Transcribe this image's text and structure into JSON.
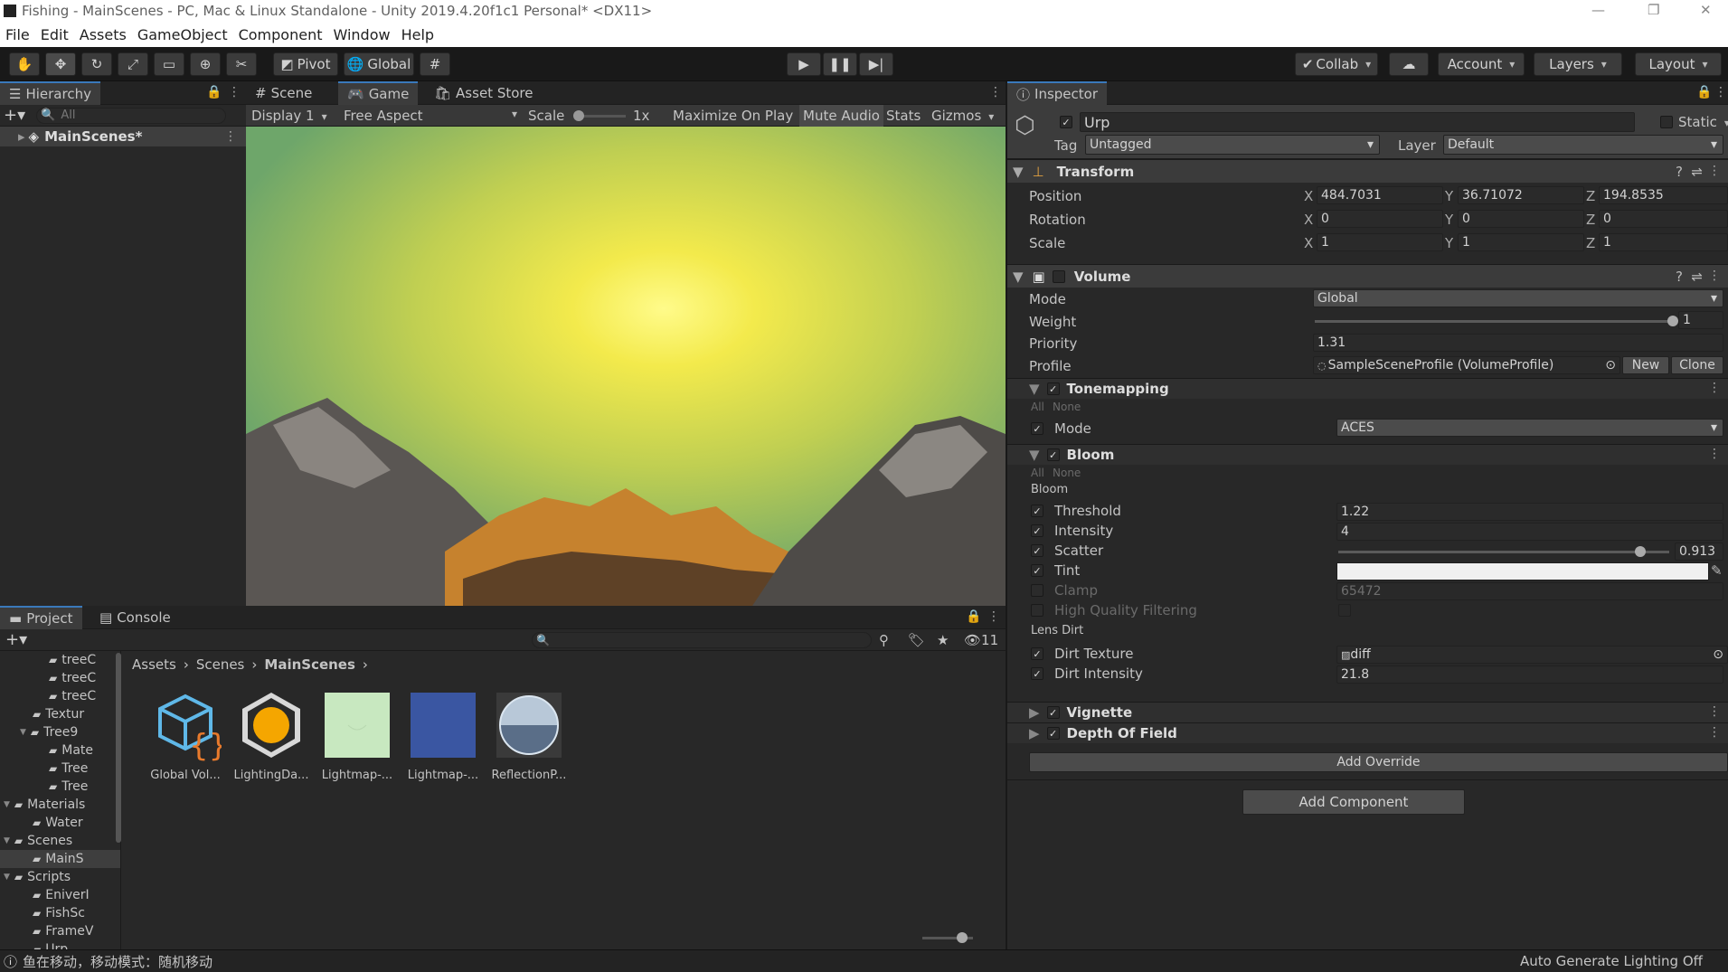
{
  "window": {
    "title": "Fishing - MainScenes - PC, Mac & Linux Standalone - Unity 2019.4.20f1c1 Personal* <DX11>"
  },
  "menu": [
    "File",
    "Edit",
    "Assets",
    "GameObject",
    "Component",
    "Window",
    "Help"
  ],
  "toolbar": {
    "pivot": "Pivot",
    "global": "Global",
    "collab": "Collab",
    "account": "Account",
    "layers": "Layers",
    "layout": "Layout"
  },
  "hierarchy": {
    "tab": "Hierarchy",
    "search_placeholder": "All",
    "scene_item": "MainScenes*"
  },
  "game": {
    "tabs": [
      "Scene",
      "Game",
      "Asset Store"
    ],
    "display": "Display 1",
    "aspect": "Free Aspect",
    "scale_label": "Scale",
    "scale_value": "1x",
    "maximize": "Maximize On Play",
    "mute": "Mute Audio",
    "stats": "Stats",
    "gizmos": "Gizmos"
  },
  "project": {
    "tabs": [
      "Project",
      "Console"
    ],
    "hidden_count": "11",
    "breadcrumb": [
      "Assets",
      "Scenes",
      "MainScenes"
    ],
    "tree": [
      {
        "label": "treeC",
        "indent": 3,
        "folder": true
      },
      {
        "label": "treeC",
        "indent": 3,
        "folder": true
      },
      {
        "label": "treeC",
        "indent": 3,
        "folder": true
      },
      {
        "label": "Textur",
        "indent": 2,
        "folder": true
      },
      {
        "label": "Tree9",
        "indent": 2,
        "folder": true,
        "open": true
      },
      {
        "label": "Mate",
        "indent": 3,
        "folder": true
      },
      {
        "label": "Tree",
        "indent": 3,
        "folder": true
      },
      {
        "label": "Tree",
        "indent": 3,
        "folder": true
      },
      {
        "label": "Materials",
        "indent": 1,
        "folder": true,
        "open": true
      },
      {
        "label": "Water",
        "indent": 2,
        "folder": true
      },
      {
        "label": "Scenes",
        "indent": 1,
        "folder": true,
        "open": true
      },
      {
        "label": "MainS",
        "indent": 2,
        "folder": true,
        "selected": true
      },
      {
        "label": "Scripts",
        "indent": 1,
        "folder": true,
        "open": true
      },
      {
        "label": "EniverI",
        "indent": 2,
        "folder": true
      },
      {
        "label": "FishSc",
        "indent": 2,
        "folder": true
      },
      {
        "label": "FrameV",
        "indent": 2,
        "folder": true
      },
      {
        "label": "Urp",
        "indent": 2,
        "folder": true
      }
    ],
    "assets": [
      {
        "label": "Global Vol...",
        "icon": "volume-profile-icon"
      },
      {
        "label": "LightingDa...",
        "icon": "lighting-data-icon"
      },
      {
        "label": "Lightmap-...",
        "icon": "lightmap-green"
      },
      {
        "label": "Lightmap-...",
        "icon": "lightmap-blue"
      },
      {
        "label": "ReflectionP...",
        "icon": "reflection-probe-icon"
      }
    ]
  },
  "inspector": {
    "tab": "Inspector",
    "object_name": "Urp",
    "static_label": "Static",
    "tag_label": "Tag",
    "tag_value": "Untagged",
    "layer_label": "Layer",
    "layer_value": "Default",
    "transform": {
      "title": "Transform",
      "position_label": "Position",
      "rotation_label": "Rotation",
      "scale_label": "Scale",
      "position": {
        "x": "484.7031",
        "y": "36.71072",
        "z": "194.8535"
      },
      "rotation": {
        "x": "0",
        "y": "0",
        "z": "0"
      },
      "scale": {
        "x": "1",
        "y": "1",
        "z": "1"
      }
    },
    "volume": {
      "title": "Volume",
      "mode_label": "Mode",
      "mode_value": "Global",
      "weight_label": "Weight",
      "weight_value": "1",
      "weight_fraction": 1.0,
      "priority_label": "Priority",
      "priority_value": "1.31",
      "profile_label": "Profile",
      "profile_value": "SampleSceneProfile (VolumeProfile)",
      "new_label": "New",
      "clone_label": "Clone"
    },
    "tonemapping": {
      "title": "Tonemapping",
      "all": "All",
      "none": "None",
      "mode_label": "Mode",
      "mode_value": "ACES"
    },
    "bloom": {
      "title": "Bloom",
      "all": "All",
      "none": "None",
      "section_bloom": "Bloom",
      "threshold_label": "Threshold",
      "threshold_value": "1.22",
      "intensity_label": "Intensity",
      "intensity_value": "4",
      "scatter_label": "Scatter",
      "scatter_value": "0.913",
      "scatter_fraction": 0.913,
      "tint_label": "Tint",
      "clamp_label": "Clamp",
      "clamp_value": "65472",
      "hq_label": "High Quality Filtering",
      "section_lens": "Lens Dirt",
      "dirt_texture_label": "Dirt Texture",
      "dirt_texture_value": "diff",
      "dirt_intensity_label": "Dirt Intensity",
      "dirt_intensity_value": "21.8"
    },
    "vignette": "Vignette",
    "dof": "Depth Of Field",
    "add_override": "Add Override",
    "add_component": "Add Component"
  },
  "status": {
    "message": "鱼在移动，移动模式：随机移动",
    "right": "Auto Generate Lighting Off"
  },
  "colors": {
    "accent": "#3a79bb",
    "panel": "#282828",
    "header": "#3b3b3b"
  }
}
